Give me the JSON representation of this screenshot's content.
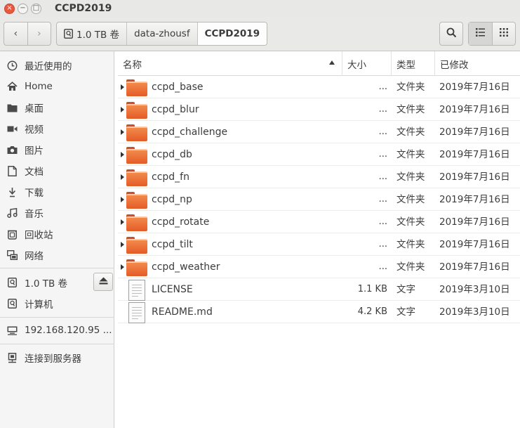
{
  "window": {
    "title": "CCPD2019",
    "controls": {
      "close": "×",
      "minimize": "−",
      "maximize": "□"
    }
  },
  "nav": {
    "back": "‹",
    "forward": "›"
  },
  "breadcrumbs": [
    {
      "label": "1.0 TB 卷",
      "icon": "drive-icon"
    },
    {
      "label": "data-zhousf"
    },
    {
      "label": "CCPD2019",
      "active": true
    }
  ],
  "sidebar": {
    "items": [
      {
        "label": "最近使用的",
        "icon": "clock-icon"
      },
      {
        "label": "Home",
        "icon": "home-icon"
      },
      {
        "label": "桌面",
        "icon": "folder-icon"
      },
      {
        "label": "视频",
        "icon": "video-icon"
      },
      {
        "label": "图片",
        "icon": "camera-icon"
      },
      {
        "label": "文档",
        "icon": "document-icon"
      },
      {
        "label": "下载",
        "icon": "download-icon"
      },
      {
        "label": "音乐",
        "icon": "music-icon"
      },
      {
        "label": "回收站",
        "icon": "trash-icon"
      },
      {
        "label": "网络",
        "icon": "network-icon"
      }
    ],
    "devices": [
      {
        "label": "1.0 TB 卷",
        "icon": "drive-icon"
      },
      {
        "label": "计算机",
        "icon": "computer-icon"
      }
    ],
    "network": [
      {
        "label": "192.168.120.95 ...",
        "icon": "server-icon"
      }
    ],
    "connect": {
      "label": "连接到服务器",
      "icon": "connect-server-icon"
    }
  },
  "columns": {
    "name": "名称",
    "size": "大小",
    "type": "类型",
    "modified": "已修改"
  },
  "files": [
    {
      "name": "ccpd_base",
      "size": "...",
      "type": "文件夹",
      "modified": "2019年7月16日",
      "kind": "folder"
    },
    {
      "name": "ccpd_blur",
      "size": "...",
      "type": "文件夹",
      "modified": "2019年7月16日",
      "kind": "folder"
    },
    {
      "name": "ccpd_challenge",
      "size": "...",
      "type": "文件夹",
      "modified": "2019年7月16日",
      "kind": "folder"
    },
    {
      "name": "ccpd_db",
      "size": "...",
      "type": "文件夹",
      "modified": "2019年7月16日",
      "kind": "folder"
    },
    {
      "name": "ccpd_fn",
      "size": "...",
      "type": "文件夹",
      "modified": "2019年7月16日",
      "kind": "folder"
    },
    {
      "name": "ccpd_np",
      "size": "...",
      "type": "文件夹",
      "modified": "2019年7月16日",
      "kind": "folder"
    },
    {
      "name": "ccpd_rotate",
      "size": "...",
      "type": "文件夹",
      "modified": "2019年7月16日",
      "kind": "folder"
    },
    {
      "name": "ccpd_tilt",
      "size": "...",
      "type": "文件夹",
      "modified": "2019年7月16日",
      "kind": "folder"
    },
    {
      "name": "ccpd_weather",
      "size": "...",
      "type": "文件夹",
      "modified": "2019年7月16日",
      "kind": "folder"
    },
    {
      "name": "LICENSE",
      "size": "1.1 KB",
      "type": "文字",
      "modified": "2019年3月10日",
      "kind": "text"
    },
    {
      "name": "README.md",
      "size": "4.2 KB",
      "type": "文字",
      "modified": "2019年3月10日",
      "kind": "text"
    }
  ],
  "colors": {
    "folder": "#e55b26",
    "close_button": "#e9573f",
    "titlebar": "#e8e8e7",
    "sidebar": "#f5f5f5"
  }
}
